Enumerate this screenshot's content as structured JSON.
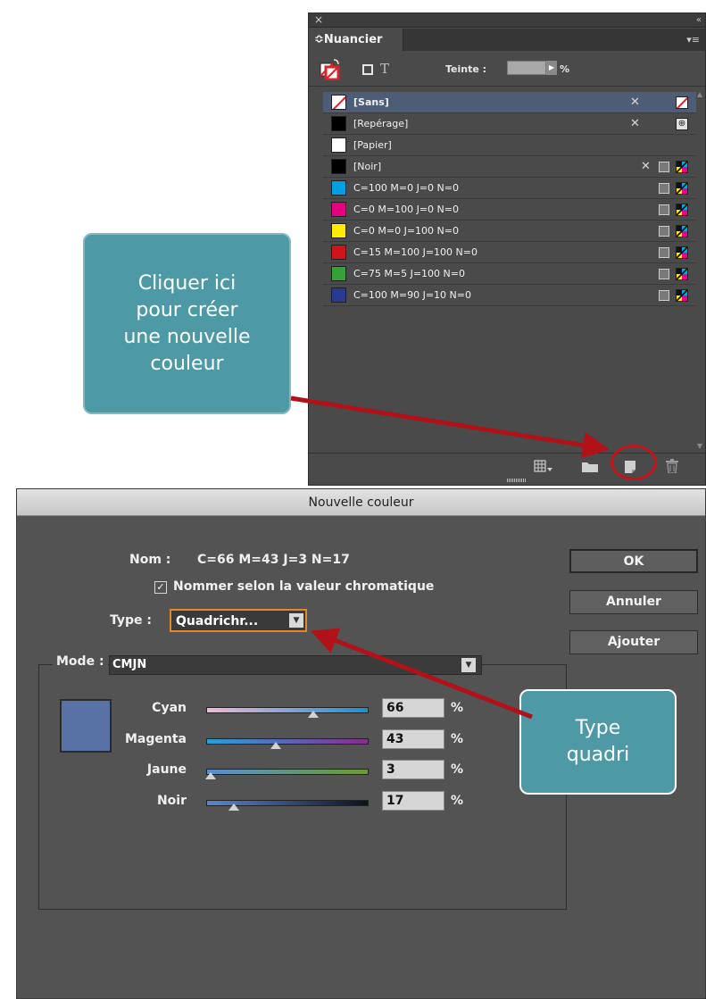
{
  "swatch_panel": {
    "close": "×",
    "collapse": "«",
    "tab_label": "≎Nuancier",
    "menu": "▾≡",
    "tint_label": "Teinte :",
    "tint_arrow": "▶",
    "tint_unit": "%",
    "text_icon": "T",
    "swatches": [
      {
        "label": "[Sans]",
        "color": "none",
        "lock": true,
        "selected": true,
        "mode": "none"
      },
      {
        "label": "[Repérage]",
        "color": "#000000",
        "lock": true,
        "mode": "registration"
      },
      {
        "label": "[Papier]",
        "color": "#ffffff"
      },
      {
        "label": "[Noir]",
        "color": "#000000",
        "lock": true,
        "spot": true,
        "mode": "cmyk"
      },
      {
        "label": "C=100 M=0 J=0 N=0",
        "color": "#00a0e3",
        "spot": true,
        "mode": "cmyk"
      },
      {
        "label": "C=0 M=100 J=0 N=0",
        "color": "#e5007e",
        "spot": true,
        "mode": "cmyk"
      },
      {
        "label": "C=0 M=0 J=100 N=0",
        "color": "#ffec00",
        "spot": true,
        "mode": "cmyk"
      },
      {
        "label": "C=15 M=100 J=100 N=0",
        "color": "#d1131b",
        "spot": true,
        "mode": "cmyk"
      },
      {
        "label": "C=75 M=5 J=100 N=0",
        "color": "#36a136",
        "spot": true,
        "mode": "cmyk"
      },
      {
        "label": "C=100 M=90 J=10 N=0",
        "color": "#2a3a8e",
        "spot": true,
        "mode": "cmyk"
      }
    ],
    "bottom_icons": [
      "grid-view-icon",
      "folder-icon",
      "new-swatch-icon",
      "trash-icon"
    ]
  },
  "callout_new_color": {
    "lines": [
      "Cliquer ici",
      "pour créer",
      "une nouvelle",
      "couleur"
    ]
  },
  "dialog": {
    "title": "Nouvelle couleur",
    "name_label": "Nom :",
    "name_value": "C=66 M=43 J=3 N=17",
    "checkbox_mark": "✓",
    "checkbox_label": "Nommer selon la valeur chromatique",
    "type_label": "Type :",
    "type_value": "Quadrichr...",
    "dropdown_arrow": "▼",
    "ok_label": "OK",
    "cancel_label": "Annuler",
    "add_label": "Ajouter",
    "mode_label": "Mode :",
    "mode_value": "CMJN",
    "preview_color": "#5872a6",
    "sliders": [
      {
        "label": "Cyan",
        "value": "66",
        "unit": "%",
        "fraction": 0.66
      },
      {
        "label": "Magenta",
        "value": "43",
        "unit": "%",
        "fraction": 0.43
      },
      {
        "label": "Jaune",
        "value": "3",
        "unit": "%",
        "fraction": 0.03
      },
      {
        "label": "Noir",
        "value": "17",
        "unit": "%",
        "fraction": 0.17
      }
    ]
  },
  "callout_type": {
    "lines": [
      "Type",
      "quadri"
    ]
  },
  "colors": {
    "callout": "#4d99a5",
    "arrow": "#b01218",
    "highlight": "#c4141b",
    "dropdown_focus": "#e08a2c"
  }
}
